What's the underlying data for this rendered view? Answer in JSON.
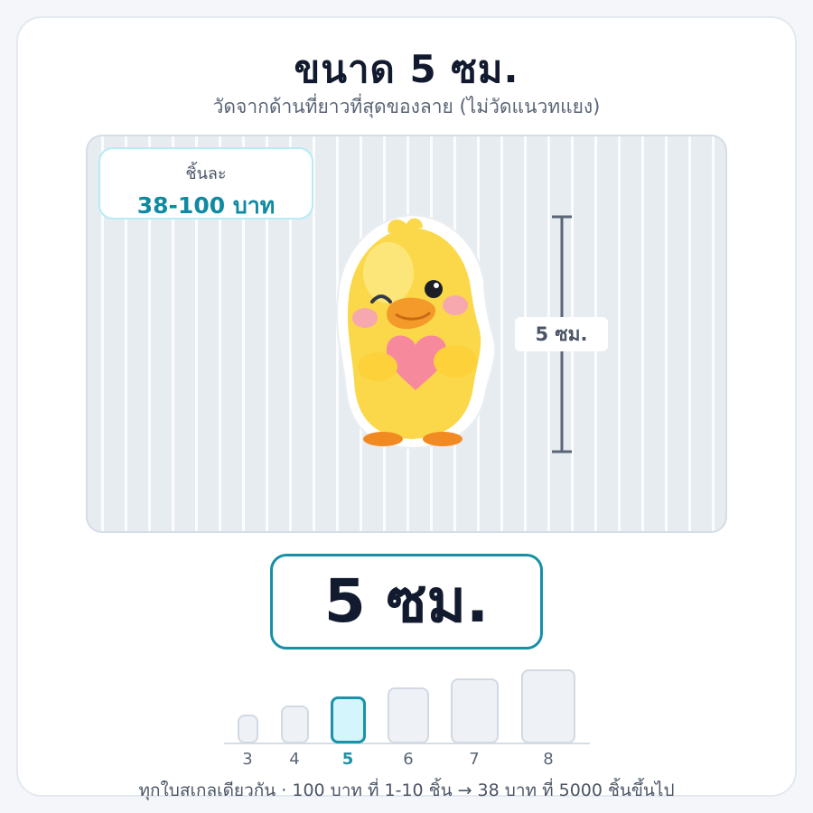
{
  "header": {
    "title": "ขนาด 5 ซม.",
    "subtitle": "วัดจากด้านที่ยาวที่สุดของลาย (ไม่วัดแนวทแยง)"
  },
  "price": {
    "label": "ชิ้นละ",
    "value": "38-100 บาท"
  },
  "preview": {
    "ruler_label": "5 ซม.",
    "sticker_icon": "duck-holding-heart-sticker"
  },
  "selected_size": {
    "label": "5 ซม."
  },
  "size_scale": {
    "options": [
      "3",
      "4",
      "5",
      "6",
      "7",
      "8"
    ],
    "selected": "5"
  },
  "footer": {
    "text": "ทุกใบสเกลเดียวกัน · 100 บาท ที่ 1-10 ชิ้น → 38 บาท ที่ 5000 ชิ้นขึ้นไป"
  },
  "colors": {
    "accent": "#1590a6",
    "price_text": "#0e8aa3",
    "selected_fill": "#d3f5fb"
  }
}
